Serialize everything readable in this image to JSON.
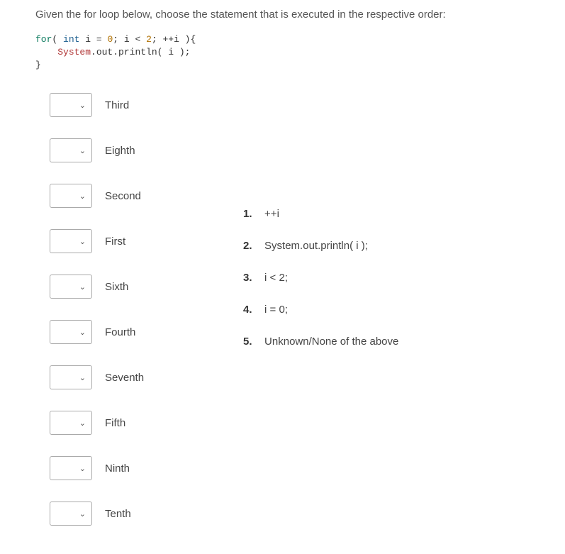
{
  "question": "Given the for loop below, choose the statement that is executed in the respective order:",
  "code": {
    "line1_for": "for",
    "line1_paren_open": "( ",
    "line1_int": "int",
    "line1_rest1": " i = ",
    "line1_zero": "0",
    "line1_rest2": "; i < ",
    "line1_two": "2",
    "line1_rest3": "; ++i ){",
    "line2_indent": "    ",
    "line2_sys": "System",
    "line2_rest": ".out.println( i );",
    "line3": "}"
  },
  "matches": [
    {
      "label": "Third"
    },
    {
      "label": "Eighth"
    },
    {
      "label": "Second"
    },
    {
      "label": "First"
    },
    {
      "label": "Sixth"
    },
    {
      "label": "Fourth"
    },
    {
      "label": "Seventh"
    },
    {
      "label": "Fifth"
    },
    {
      "label": "Ninth"
    },
    {
      "label": "Tenth"
    }
  ],
  "answers": [
    {
      "num": "1.",
      "text": "++i"
    },
    {
      "num": "2.",
      "text": "System.out.println( i );"
    },
    {
      "num": "3.",
      "text": "i < 2;"
    },
    {
      "num": "4.",
      "text": "i = 0;"
    },
    {
      "num": "5.",
      "text": "Unknown/None of the above"
    }
  ]
}
